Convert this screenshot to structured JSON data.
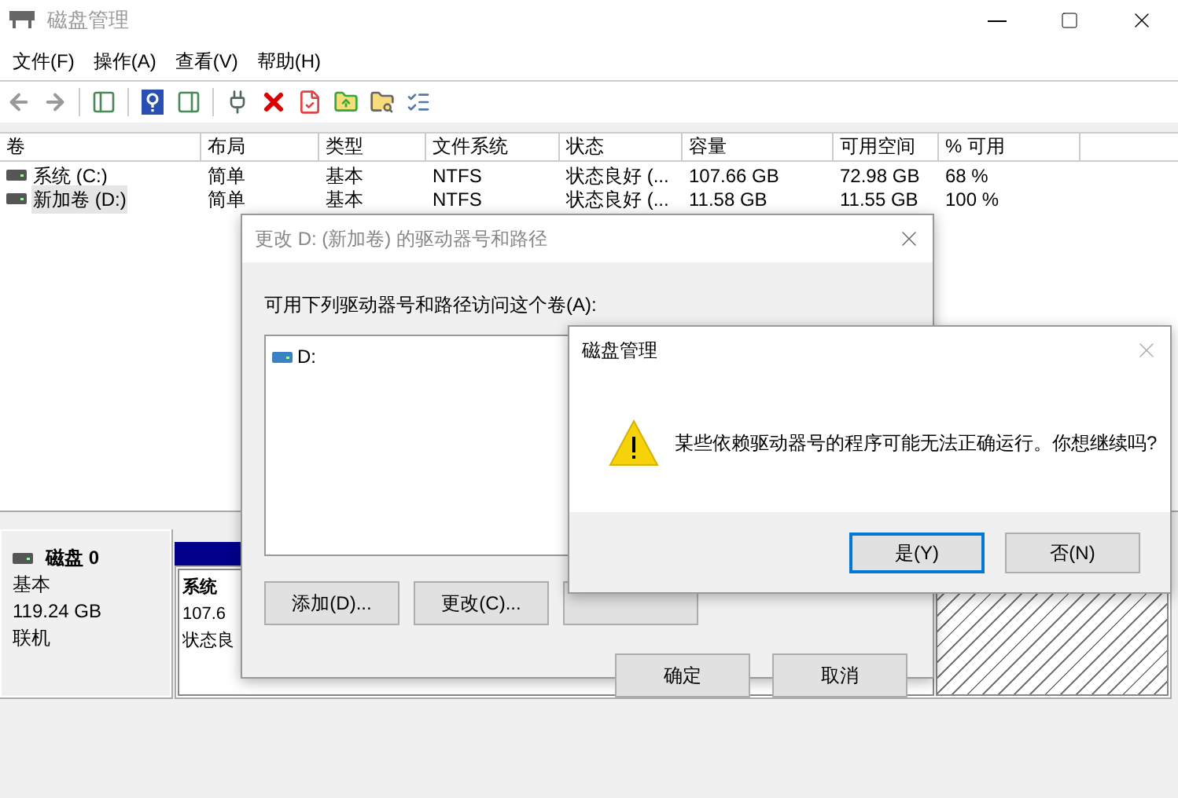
{
  "window": {
    "title": "磁盘管理"
  },
  "menu": [
    "文件(F)",
    "操作(A)",
    "查看(V)",
    "帮助(H)"
  ],
  "table": {
    "columns": [
      "卷",
      "布局",
      "类型",
      "文件系统",
      "状态",
      "容量",
      "可用空间",
      "% 可用"
    ],
    "rows": [
      {
        "cells": [
          "系统 (C:)",
          "简单",
          "基本",
          "NTFS",
          "状态良好 (...",
          "107.66 GB",
          "72.98 GB",
          "68 %"
        ],
        "selected": false
      },
      {
        "cells": [
          "新加卷 (D:)",
          "简单",
          "基本",
          "NTFS",
          "状态良好 (...",
          "11.58 GB",
          "11.55 GB",
          "100 %"
        ],
        "selected": true
      }
    ]
  },
  "disk": {
    "name": "磁盘 0",
    "type": "基本",
    "size": "119.24 GB",
    "status": "联机",
    "partitions": [
      {
        "kind": "volume",
        "name": "系统",
        "size": "107.6",
        "status": "状态良"
      },
      {
        "kind": "hatched"
      }
    ]
  },
  "change_dialog": {
    "title": "更改 D: (新加卷) 的驱动器号和路径",
    "label": "可用下列驱动器号和路径访问这个卷(A):",
    "paths": [
      "D:"
    ],
    "actions": [
      "添加(D)...",
      "更改(C)..."
    ],
    "footer_buttons": [
      "确定",
      "取消"
    ]
  },
  "confirm_dialog": {
    "title": "磁盘管理",
    "message": "某些依赖驱动器号的程序可能无法正确运行。你想继续吗?",
    "buttons": [
      {
        "label": "是(Y)",
        "focused": true
      },
      {
        "label": "否(N)",
        "focused": false
      }
    ]
  }
}
